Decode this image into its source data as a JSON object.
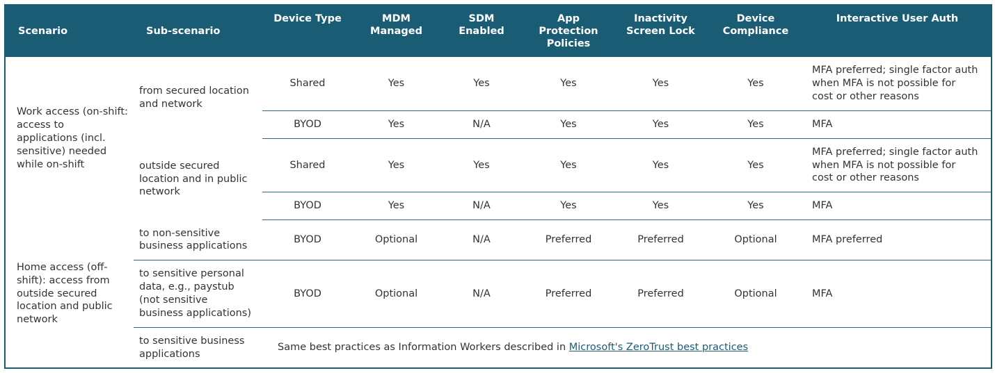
{
  "headers": {
    "scenario": "Scenario",
    "sub": "Sub-scenario",
    "dtype": "Device Type",
    "mdm": "MDM Managed",
    "sdm": "SDM Enabled",
    "app": "App Protection Policies",
    "inact": "Inactivity Screen Lock",
    "dc": "Device Compliance",
    "auth": "Interactive User Auth"
  },
  "scenarios": {
    "work": "Work access (on-shift: access to applications (incl. sensitive) needed while on-shift",
    "home": "Home access (off-shift): access from outside secured location and public network"
  },
  "sub": {
    "secured": "from secured location and network",
    "outside": "outside secured location and in public network",
    "nonsens": "to non-sensitive business applications",
    "senspers": "to sensitive personal data, e.g., paystub (not sensitive business applications)",
    "sensbiz": "to sensitive business applications"
  },
  "v": {
    "shared": "Shared",
    "byod": "BYOD",
    "yes": "Yes",
    "na": "N/A",
    "optional": "Optional",
    "preferred": "Preferred",
    "mfa": "MFA",
    "mfapref": "MFA preferred",
    "mfalong": "MFA preferred; single factor auth when MFA is not possible for cost or other reasons"
  },
  "note": {
    "prefix": "Same best practices as Information Workers described in ",
    "link": "Microsoft's ZeroTrust best practices"
  }
}
